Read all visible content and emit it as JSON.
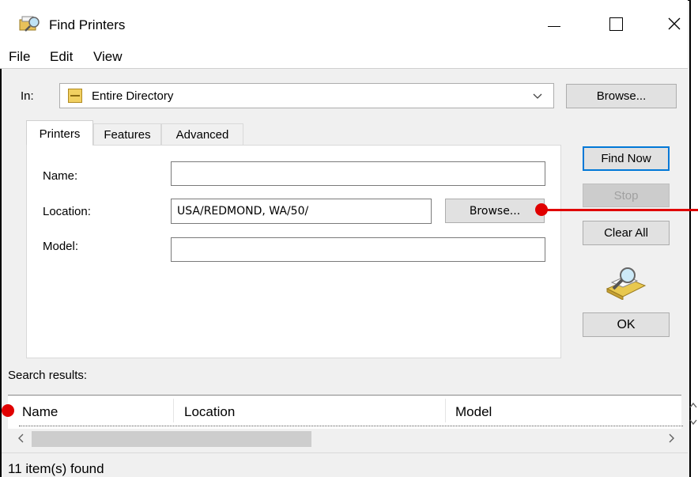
{
  "window": {
    "title": "Find Printers",
    "minimize_icon": "minimize-icon",
    "maximize_icon": "maximize-icon",
    "close_icon": "close-icon"
  },
  "menu": {
    "items": [
      "File",
      "Edit",
      "View"
    ]
  },
  "in_row": {
    "label": "In:",
    "selected": "Entire Directory",
    "browse_label": "Browse..."
  },
  "tabs": [
    "Printers",
    "Features",
    "Advanced"
  ],
  "form": {
    "name_label": "Name:",
    "name_value": "",
    "location_label": "Location:",
    "location_value": "USA/REDMOND, WA/50/",
    "location_browse": "Browse...",
    "model_label": "Model:",
    "model_value": ""
  },
  "side_buttons": {
    "find_now": "Find Now",
    "stop": "Stop",
    "clear_all": "Clear All",
    "ok": "OK"
  },
  "results": {
    "label": "Search results:",
    "columns": [
      "Name",
      "Location",
      "Model"
    ],
    "status": "11 item(s) found"
  },
  "colors": {
    "accent": "#0078d7",
    "annotation": "#e00000"
  }
}
